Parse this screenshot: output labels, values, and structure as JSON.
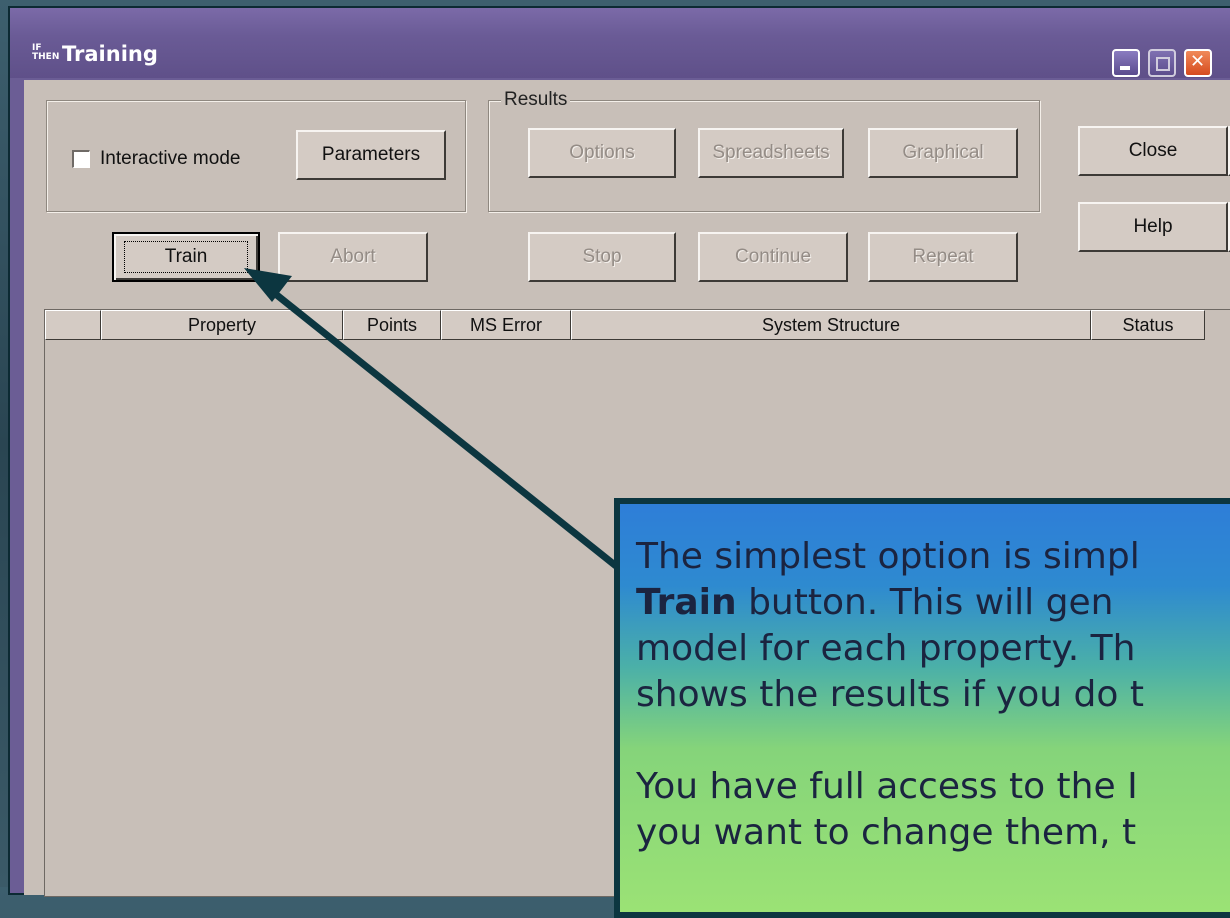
{
  "window": {
    "title": "Training",
    "app_icon_top": "IF",
    "app_icon_bottom": "THEN"
  },
  "controls": {
    "interactive_mode_label": "Interactive mode",
    "parameters_label": "Parameters",
    "results_group_label": "Results",
    "options_label": "Options",
    "spreadsheets_label": "Spreadsheets",
    "graphical_label": "Graphical",
    "close_label": "Close",
    "help_label": "Help",
    "train_label": "Train",
    "abort_label": "Abort",
    "stop_label": "Stop",
    "continue_label": "Continue",
    "repeat_label": "Repeat"
  },
  "grid": {
    "columns": [
      "",
      "Property",
      "Points",
      "MS Error",
      "System Structure",
      "Status"
    ]
  },
  "callout": {
    "line1": "The simplest option is simpl",
    "line2_bold": "Train",
    "line2_rest": " button.  This will gen",
    "line3": "model for each property.  Th",
    "line4": "shows the results if you do t",
    "line5": "You have full access to the I",
    "line6": "you want to change them, t"
  }
}
